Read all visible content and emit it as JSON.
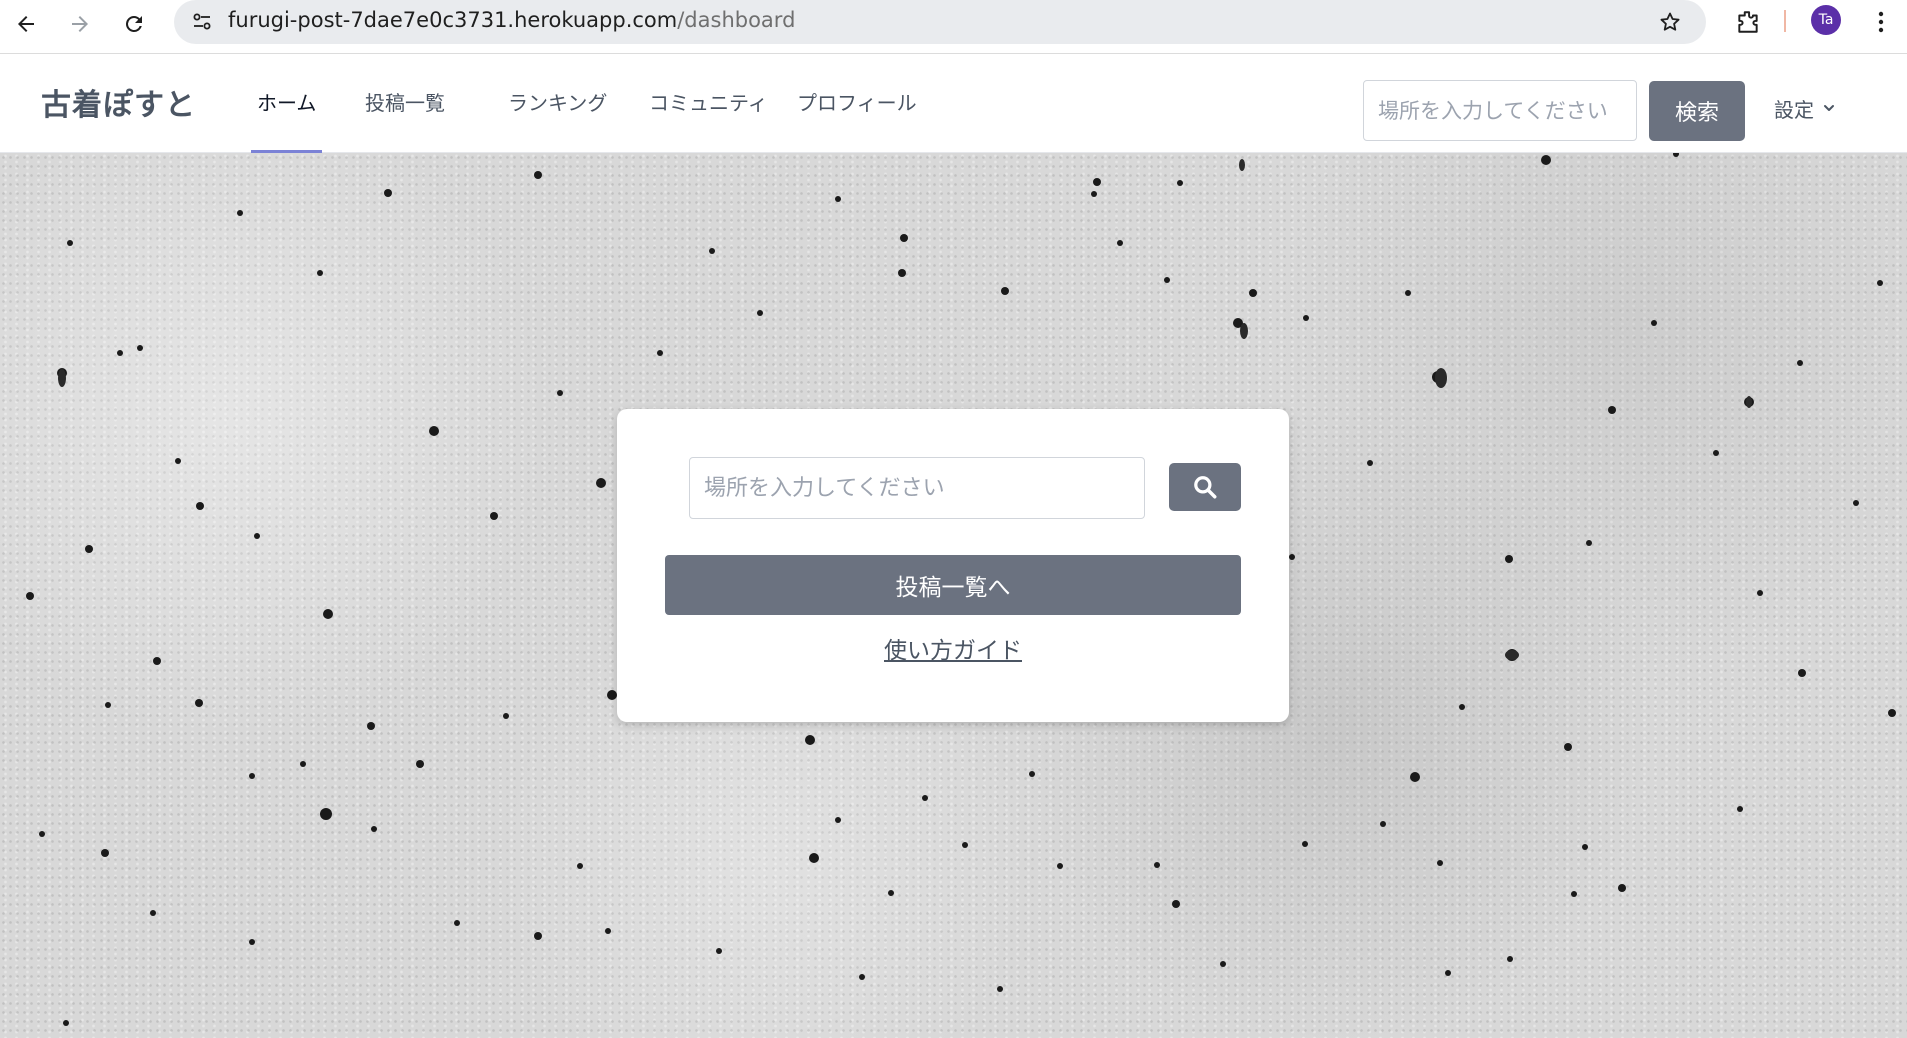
{
  "browser": {
    "url_host": "furugi-post-7dae7e0c3731.herokuapp.com",
    "url_path": "/dashboard",
    "profile_initials": "Ta",
    "icons": [
      "back-icon",
      "forward-icon",
      "reload-icon",
      "site-info-icon",
      "bookmark-star-icon",
      "extensions-icon",
      "menu-kebab-icon"
    ]
  },
  "header": {
    "brand": "古着ぽすと",
    "nav": [
      {
        "label": "ホーム",
        "active": true
      },
      {
        "label": "投稿一覧",
        "active": false
      },
      {
        "label": "ランキング",
        "active": false
      },
      {
        "label": "コミュニティ",
        "active": false
      },
      {
        "label": "プロフィール",
        "active": false
      }
    ],
    "search_placeholder": "場所を入力してください",
    "search_button": "検索",
    "settings_label": "設定"
  },
  "card": {
    "search_placeholder": "場所を入力してください",
    "posts_button": "投稿一覧へ",
    "guide_link": "使い方ガイド"
  },
  "colors": {
    "accent": "#6b7280",
    "active_underline": "#7b82d6",
    "avatar": "#5b2fa8"
  }
}
